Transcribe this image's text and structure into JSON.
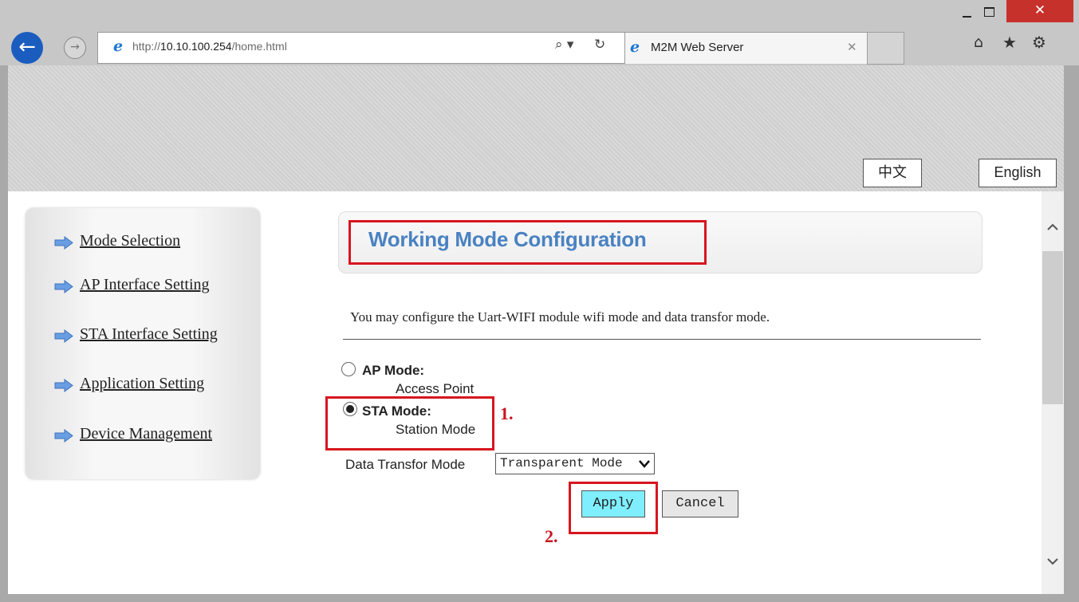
{
  "browser": {
    "window_close_glyph": "✕",
    "back_glyph": "←",
    "forward_glyph": "→",
    "address_prefix": "http://",
    "address_host": "10.10.100.254",
    "address_path": "/home.html",
    "search_glyph": "⌕ ▾",
    "refresh_glyph": "↻",
    "ie_glyph": "e",
    "tab_title": "M2M Web Server",
    "tab_close_glyph": "✕",
    "home_glyph": "⌂",
    "star_glyph": "★",
    "gear_glyph": "⚙"
  },
  "language": {
    "chinese": "中文",
    "english": "English"
  },
  "sidebar": {
    "items": [
      {
        "label": "Mode Selection"
      },
      {
        "label": "AP Interface Setting"
      },
      {
        "label": "STA Interface Setting"
      },
      {
        "label": "Application Setting"
      },
      {
        "label": "Device Management"
      }
    ]
  },
  "main": {
    "title": "Working Mode Configuration",
    "description": "You may configure the Uart-WIFI module wifi mode and data transfor mode.",
    "ap_mode": {
      "title": "AP Mode:",
      "subtitle": "Access Point",
      "selected": false
    },
    "sta_mode": {
      "title": "STA Mode:",
      "subtitle": "Station Mode",
      "selected": true
    },
    "data_transfor_label": "Data Transfor Mode",
    "data_transfor_value": "Transparent Mode",
    "select_chevron": "🗸",
    "apply_label": "Apply",
    "cancel_label": "Cancel"
  },
  "annotations": {
    "step1": "1.",
    "step2": "2."
  },
  "scrollbar": {
    "up_glyph": "^",
    "down_glyph": "v"
  },
  "colors": {
    "title_blue": "#4a82c2",
    "highlight_red": "#d7161f",
    "apply_bg": "#7fefff",
    "ie_blue": "#1b5dbf"
  }
}
